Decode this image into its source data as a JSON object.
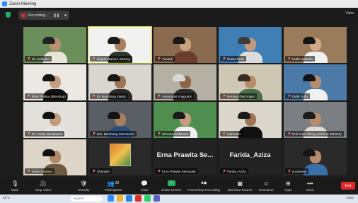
{
  "window": {
    "title": "Zoom Meeting"
  },
  "recording": {
    "label": "Recording...",
    "pause_icon": "pause-icon",
    "stop_icon": "stop-icon"
  },
  "view": {
    "label": "View"
  },
  "tiles": [
    {
      "name": "Dr. Salmaini",
      "bg": "#6b8f5a",
      "skin": "#b98f6f",
      "hair": "#222",
      "shirt": "#e9e4d8"
    },
    {
      "name": "Deputi Wamen Sesneg",
      "bg": "#f1f1ef",
      "skin": "#a8805e",
      "hair": "#1a1a1a",
      "shirt": "#30342f"
    },
    {
      "name": "Yaniarti",
      "bg": "#8a6b4f",
      "skin": "#c8a07e",
      "hair": "#1a1a1a",
      "shirt": "#6c3d2f"
    },
    {
      "name": "Diana Tantri",
      "bg": "#3f7fb5",
      "skin": "#c59a7c",
      "hair": "#3b3b3b",
      "shirt": "#dcdcdc"
    },
    {
      "name": "Eddie Saputra",
      "bg": "#9a7b5c",
      "skin": "#d0a887",
      "hair": "#151515",
      "shirt": "#efefef"
    },
    {
      "name": "Rina Tristina (Blending)",
      "bg": "#ece9e4",
      "skin": "#c79e80",
      "hair": "#141414",
      "shirt": "#111"
    },
    {
      "name": "Dr. Bambang Irianto",
      "bg": "#d9d6d0",
      "skin": "#9c7456",
      "hair": "#161616",
      "shirt": "#2a2a2a"
    },
    {
      "name": "Aswansari Anggraini",
      "bg": "#b5b0a4",
      "skin": "#8d6447",
      "hair": "#d8d8d8",
      "shirt": "#2d2d2d"
    },
    {
      "name": "Nenang Dwi Anjani",
      "bg": "#cfc8b5",
      "skin": "#b68c6a",
      "hair": "#3b2b22",
      "shirt": "#4d6f47"
    },
    {
      "name": "Didik Yutra",
      "bg": "#4b7aa8",
      "skin": "#b78d6f",
      "hair": "#141414",
      "shirt": "#f0f0f0"
    },
    {
      "name": "Dr. Taufiq Wicaksana",
      "bg": "#e2e0da",
      "skin": "#c49b7b",
      "hair": "#121212",
      "shirt": "#e6e6e6"
    },
    {
      "name": "Drs. Bambang Darmawan",
      "bg": "#5a5f66",
      "skin": "#a7805f",
      "hair": "#141414",
      "shirt": "#2a4d7a"
    },
    {
      "name": "Wiratna Widiastuti",
      "bg": "#4f8e4f",
      "skin": "#c49d80",
      "hair": "#1a1a1a",
      "shirt": "#f0f0f0"
    },
    {
      "name": "Indrawan",
      "bg": "#dcd7cc",
      "skin": "#9e7458",
      "hair": "#1a1a1a",
      "shirt": "#111"
    },
    {
      "name": "Erni Andri Bilang (Dirbina Bahasa)",
      "bg": "#7b7f84",
      "skin": "#b68c6c",
      "hair": "#1a1a1a",
      "shirt": "#e0ddd8"
    },
    {
      "name": "Dede Santoso",
      "bg": "#ddd6c8",
      "skin": "#b08868",
      "hair": "#111",
      "shirt": "#6e5a3e"
    },
    {
      "name": "Shanijah",
      "bg": "#2a2a2a"
    },
    {
      "name": "Erna Prawita Setyowati",
      "big": "Erna Prawita Se...",
      "bg": "#232323"
    },
    {
      "name": "Farida_Aziza",
      "big": "Farida_Aziza",
      "bg": "#232323"
    },
    {
      "name": "yunaenny",
      "bg": "#2a2a2a",
      "skin": "#b68c6c",
      "hair": "#151515",
      "shirt": "#3a6fa8"
    }
  ],
  "toolbar": {
    "mute": {
      "label": "Mute",
      "icon": "microphone-icon"
    },
    "video": {
      "label": "Stop Video",
      "icon": "video-camera-icon"
    },
    "security": {
      "label": "Security",
      "icon": "shield-icon"
    },
    "participants": {
      "label": "Participants",
      "count": "20",
      "icon": "participants-icon"
    },
    "chat": {
      "label": "Chat",
      "icon": "chat-icon"
    },
    "share": {
      "label": "Share Screen",
      "icon": "share-screen-icon",
      "color": "#27ae60"
    },
    "pause_recording": {
      "label": "Pause/Stop Recording",
      "icon": "pause-recording-icon"
    },
    "breakout": {
      "label": "Breakout Rooms",
      "icon": "breakout-rooms-icon"
    },
    "reactions": {
      "label": "Reactions",
      "icon": "reactions-icon"
    },
    "apps": {
      "label": "Apps",
      "icon": "apps-icon"
    },
    "more": {
      "label": "More",
      "icon": "more-icon"
    },
    "end": {
      "label": "End"
    }
  },
  "taskbar": {
    "weather": "29°C",
    "search_placeholder": "Search",
    "tray": "ENG"
  }
}
